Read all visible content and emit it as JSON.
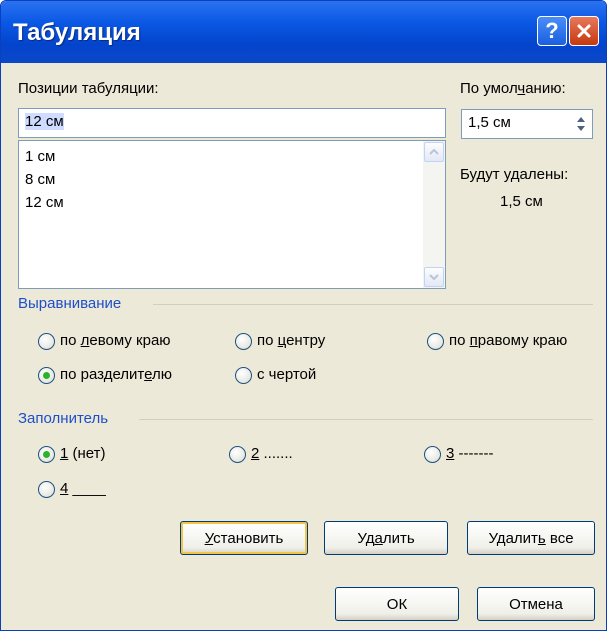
{
  "window": {
    "title": "Табуляция"
  },
  "positions": {
    "label": "Позиции табуляции:",
    "value": "12 см",
    "list": [
      "1 см",
      "8 см",
      "12 см"
    ]
  },
  "default": {
    "label": "По умолчанию:",
    "value": "1,5 см"
  },
  "remove": {
    "label": "Будут удалены:",
    "value": "1,5 см"
  },
  "alignment": {
    "title": "Выравнивание",
    "options": [
      "по левому краю",
      "по центру",
      "по правому краю",
      "по разделителю",
      "с чертой"
    ],
    "selected": "по разделителю"
  },
  "leader": {
    "title": "Заполнитель",
    "options": [
      "1 (нет)",
      "2 .......",
      "3 -------",
      "4 ____"
    ],
    "selected": "1 (нет)"
  },
  "buttons": {
    "set": "Установить",
    "delete": "Удалить",
    "delete_all": "Удалить все",
    "ok": "ОК",
    "cancel": "Отмена"
  },
  "colors": {
    "title_bar": "#0a58e4",
    "group_title": "#1f4ec9",
    "dialog_bg": "#ece9d8"
  }
}
